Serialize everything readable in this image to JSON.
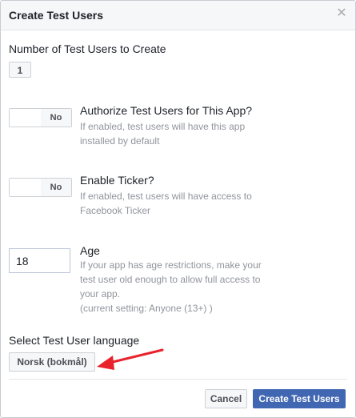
{
  "dialog": {
    "title": "Create Test Users",
    "close_icon": "close-icon",
    "close_glyph": "✕"
  },
  "count": {
    "label": "Number of Test Users to Create",
    "value": "1"
  },
  "authorize": {
    "title": "Authorize Test Users for This App?",
    "toggle_state": "No",
    "desc_line1": "If enabled, test users will have this app",
    "desc_line2": "installed by default"
  },
  "ticker": {
    "title": "Enable Ticker?",
    "toggle_state": "No",
    "desc_line1": "If enabled, test users will have access to",
    "desc_line2": "Facebook Ticker"
  },
  "age": {
    "title": "Age",
    "value": "18",
    "desc_line1": "If your app has age restrictions, make your",
    "desc_line2": "test user old enough to allow full access to",
    "desc_line3": "your app.",
    "desc_line4": "(current setting: Anyone (13+) )"
  },
  "language": {
    "label": "Select Test User language",
    "value": "Norsk (bokmål)"
  },
  "footer": {
    "cancel_label": "Cancel",
    "create_label": "Create Test Users"
  },
  "colors": {
    "primary": "#4267b2",
    "annotation_arrow": "#e8232c"
  }
}
